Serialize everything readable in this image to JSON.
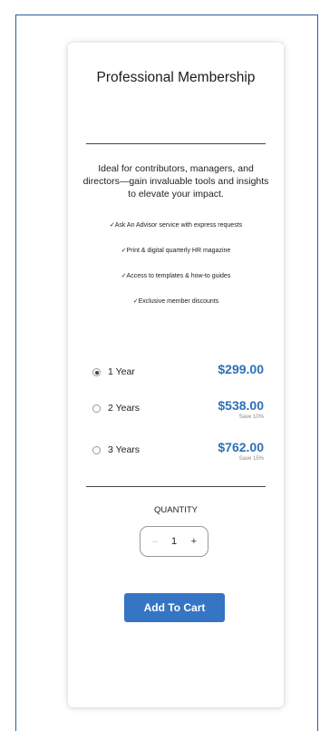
{
  "card": {
    "title": "Professional Membership",
    "description": "Ideal for contributors, managers, and directors—gain invaluable tools and insights to elevate your impact.",
    "features": [
      "✓Ask An Advisor service with express requests",
      "✓Print & digital quarterly HR magazine",
      "✓Access to templates & how-to guides",
      "✓Exclusive member discounts"
    ],
    "options": [
      {
        "label": "1 Year",
        "price": "$299.00",
        "save": "",
        "selected": true
      },
      {
        "label": "2 Years",
        "price": "$538.00",
        "save": "Save 10%",
        "selected": false
      },
      {
        "label": "3 Years",
        "price": "$762.00",
        "save": "Save 15%",
        "selected": false
      }
    ],
    "quantity": {
      "label": "QUANTITY",
      "value": "1",
      "minus": "–",
      "plus": "+"
    },
    "add_to_cart": "Add To Cart"
  },
  "colors": {
    "accent": "#3575c4",
    "price": "#2f6fb8",
    "frame_border": "#2f5b93"
  }
}
